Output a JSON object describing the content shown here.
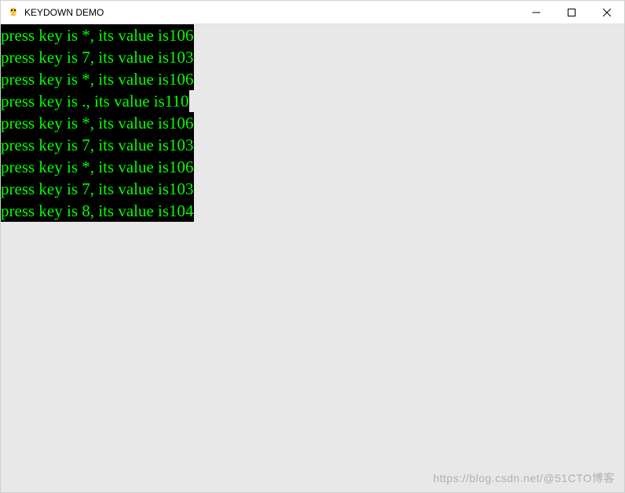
{
  "window": {
    "title": "KEYDOWN DEMO"
  },
  "log": {
    "lines": [
      "press key is *, its value is106",
      "press key is 7, its value is103",
      "press key is *, its value is106",
      "press key is ., its value is110",
      "press key is *, its value is106",
      "press key is 7, its value is103",
      "press key is *, its value is106",
      "press key is 7, its value is103",
      "press key is 8, its value is104"
    ]
  },
  "watermark": "https://blog.csdn.net/@51CTO博客"
}
